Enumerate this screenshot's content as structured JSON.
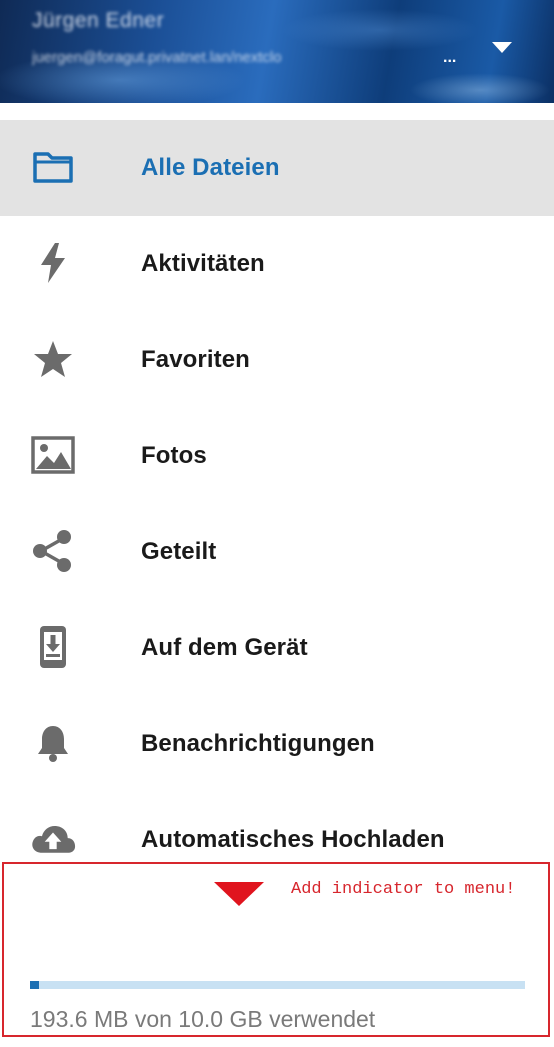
{
  "header": {
    "account_name": "Jürgen Edner",
    "account_email": "juergen@foragut.privatnet.lan/nextclo",
    "email_truncation": "...",
    "dropdown_icon": "caret-down-icon"
  },
  "nav": {
    "items": [
      {
        "label": "Alle Dateien",
        "icon": "folder-icon",
        "active": true
      },
      {
        "label": "Aktivitäten",
        "icon": "lightning-icon",
        "active": false
      },
      {
        "label": "Favoriten",
        "icon": "star-icon",
        "active": false
      },
      {
        "label": "Fotos",
        "icon": "image-icon",
        "active": false
      },
      {
        "label": "Geteilt",
        "icon": "share-icon",
        "active": false
      },
      {
        "label": "Auf dem Gerät",
        "icon": "phone-download-icon",
        "active": false
      },
      {
        "label": "Benachrichtigungen",
        "icon": "bell-icon",
        "active": false
      },
      {
        "label": "Automatisches Hochladen",
        "icon": "cloud-upload-icon",
        "active": false
      }
    ]
  },
  "annotation": {
    "text": "Add indicator to menu!",
    "arrow_icon": "red-triangle-down-icon",
    "color": "#d7262d"
  },
  "quota": {
    "used_fraction": 0.019,
    "text": "193.6 MB von 10.0 GB verwendet"
  },
  "colors": {
    "accent": "#1b6fb3",
    "active_background": "#e3e3e3",
    "icon_gray": "#6b6b6b",
    "quota_track": "#c8e1f3"
  }
}
